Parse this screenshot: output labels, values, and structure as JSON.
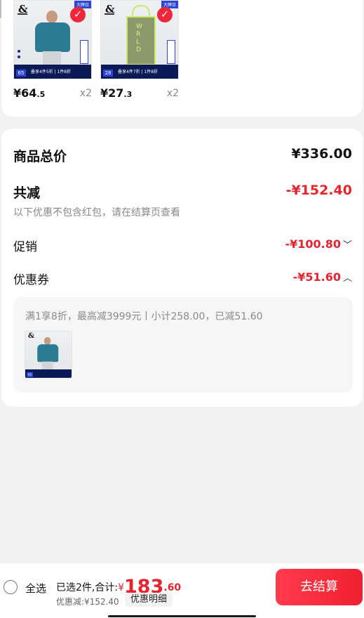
{
  "products": [
    {
      "price_symbol": "¥",
      "price_int": "64",
      "price_dec": ".5",
      "qty": "x2",
      "corner_tag": "大牌日",
      "promo_num": "65",
      "promo_text": "叠享4件5折 | 1件8折",
      "brand": "&"
    },
    {
      "price_symbol": "¥",
      "price_int": "27",
      "price_dec": ".3",
      "qty": "x2",
      "corner_tag": "大牌日",
      "promo_num": "28",
      "promo_text": "叠享4件7折 | 1件8折",
      "brand": "&"
    }
  ],
  "summary": {
    "goods_total_label": "商品总价",
    "goods_total_value": "¥336.00",
    "reduction_label": "共减",
    "reduction_value": "-¥152.40",
    "reduction_note": "以下优惠不包含红包，请在结算页查看",
    "promo_label": "促销",
    "promo_value": "-¥100.80",
    "coupon_label": "优惠券",
    "coupon_value": "-¥51.60",
    "coupon_desc": "满1享8折，最高减3999元丨小计258.00，已减51.60"
  },
  "bottom_bar": {
    "select_all": "全选",
    "selected_text": "已选2件,合计:",
    "total_symbol": "¥",
    "total_int": "183",
    "total_dec": ".60",
    "discount_text": "优惠减:¥152.40",
    "detail_btn": "优惠明细",
    "checkout_btn": "去结算"
  },
  "colors": {
    "accent_red": "#e8232d",
    "checkout_start": "#ff3b4e",
    "checkout_end": "#f0202f"
  },
  "icons": {
    "check": "check-icon",
    "chevron_down": "chevron-down-icon",
    "chevron_up": "chevron-up-icon",
    "radio": "radio-icon"
  }
}
